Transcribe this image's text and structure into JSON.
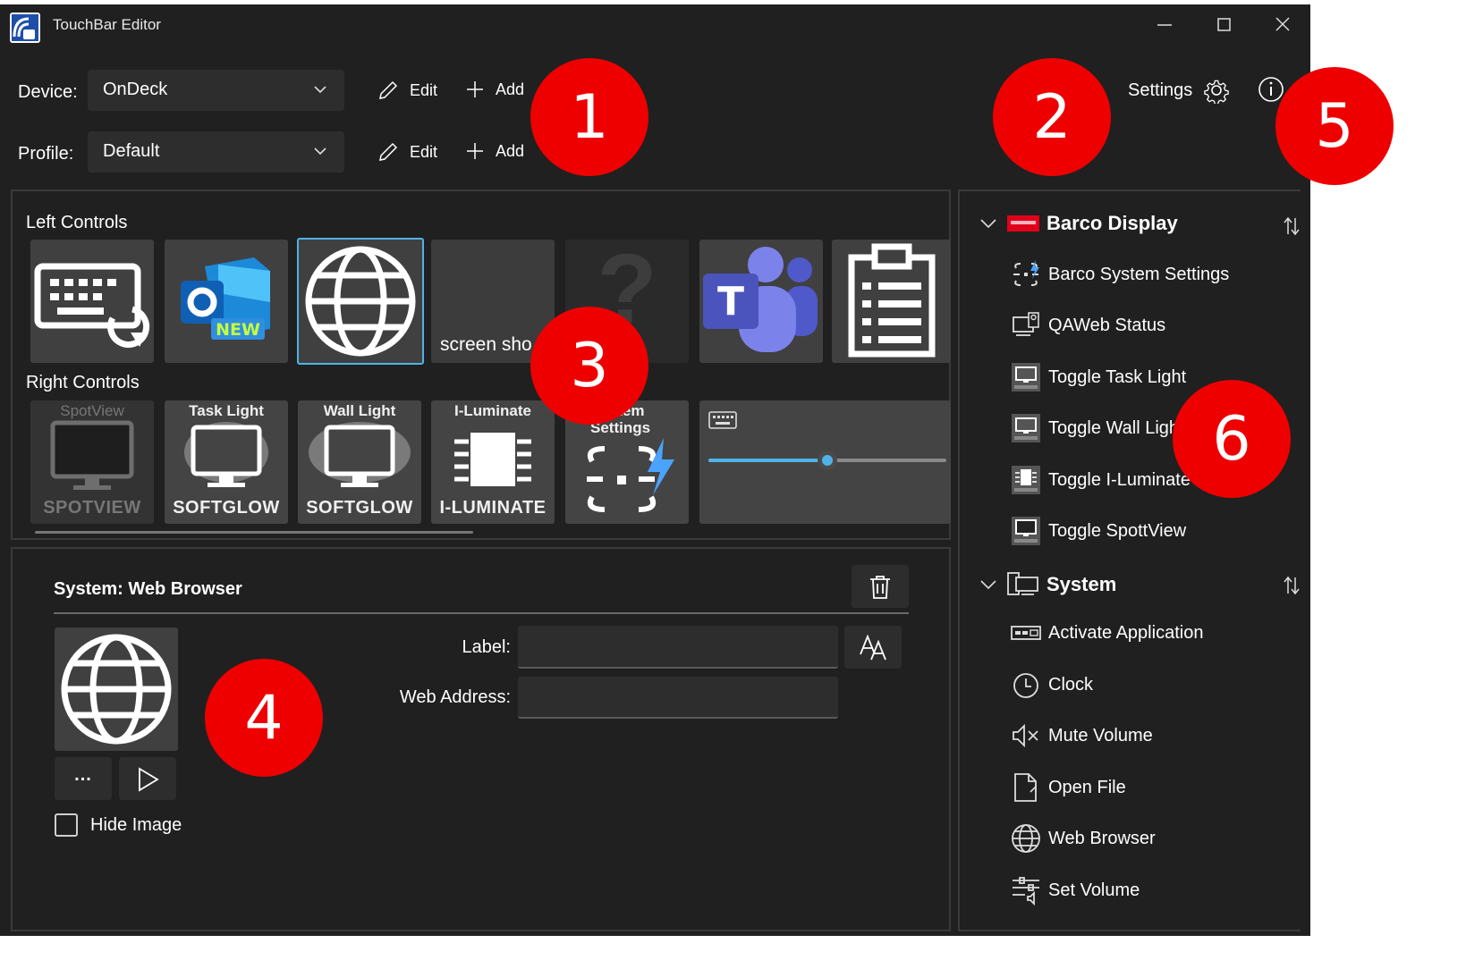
{
  "window": {
    "title": "TouchBar Editor"
  },
  "toolbar": {
    "device_label": "Device:",
    "device_value": "OnDeck",
    "profile_label": "Profile:",
    "profile_value": "Default",
    "edit_label": "Edit",
    "add_label": "Add",
    "settings_label": "Settings"
  },
  "controls": {
    "left_title": "Left Controls",
    "right_title": "Right Controls",
    "left_tiles": [
      {
        "name": "keyboard-refresh",
        "caption": ""
      },
      {
        "name": "outlook-new",
        "caption": "NEW"
      },
      {
        "name": "web-browser",
        "caption": ""
      },
      {
        "name": "screenshot",
        "caption": "screen sho"
      },
      {
        "name": "unknown",
        "caption": "?"
      },
      {
        "name": "teams",
        "caption": "T"
      },
      {
        "name": "clipboard",
        "caption": ""
      }
    ],
    "right_tiles": [
      {
        "name": "spotview",
        "top": "SpotView",
        "bottom": "SPOTVIEW"
      },
      {
        "name": "task-light",
        "top": "Task Light",
        "bottom": "SOFTGLOW"
      },
      {
        "name": "wall-light",
        "top": "Wall Light",
        "bottom": "SOFTGLOW"
      },
      {
        "name": "i-luminate",
        "top": "I-Luminate",
        "bottom": "I-LUMINATE"
      },
      {
        "name": "system-settings",
        "top": "System Settings",
        "bottom": ""
      }
    ],
    "slider_value": 0.5
  },
  "detail": {
    "title": "System: Web Browser",
    "label_label": "Label:",
    "label_value": "",
    "address_label": "Web Address:",
    "address_value": "",
    "more_label": "...",
    "hide_image_label": "Hide Image",
    "hide_image_checked": false
  },
  "library": {
    "groups": [
      {
        "title": "Barco Display",
        "items": [
          "Barco System Settings",
          "QAWeb Status",
          "Toggle Task Light",
          "Toggle Wall Ligh",
          "Toggle I-Luminate",
          "Toggle SpottView"
        ]
      },
      {
        "title": "System",
        "items": [
          "Activate Application",
          "Clock",
          "Mute Volume",
          "Open File",
          "Web Browser",
          "Set Volume"
        ]
      }
    ]
  },
  "markers": [
    "1",
    "2",
    "3",
    "4",
    "5",
    "6"
  ],
  "colors": {
    "accent": "#4fb3e8",
    "marker": "#ee0000",
    "background": "#202020",
    "surface": "#2d2d2d",
    "barco_red": "#e0001b"
  }
}
